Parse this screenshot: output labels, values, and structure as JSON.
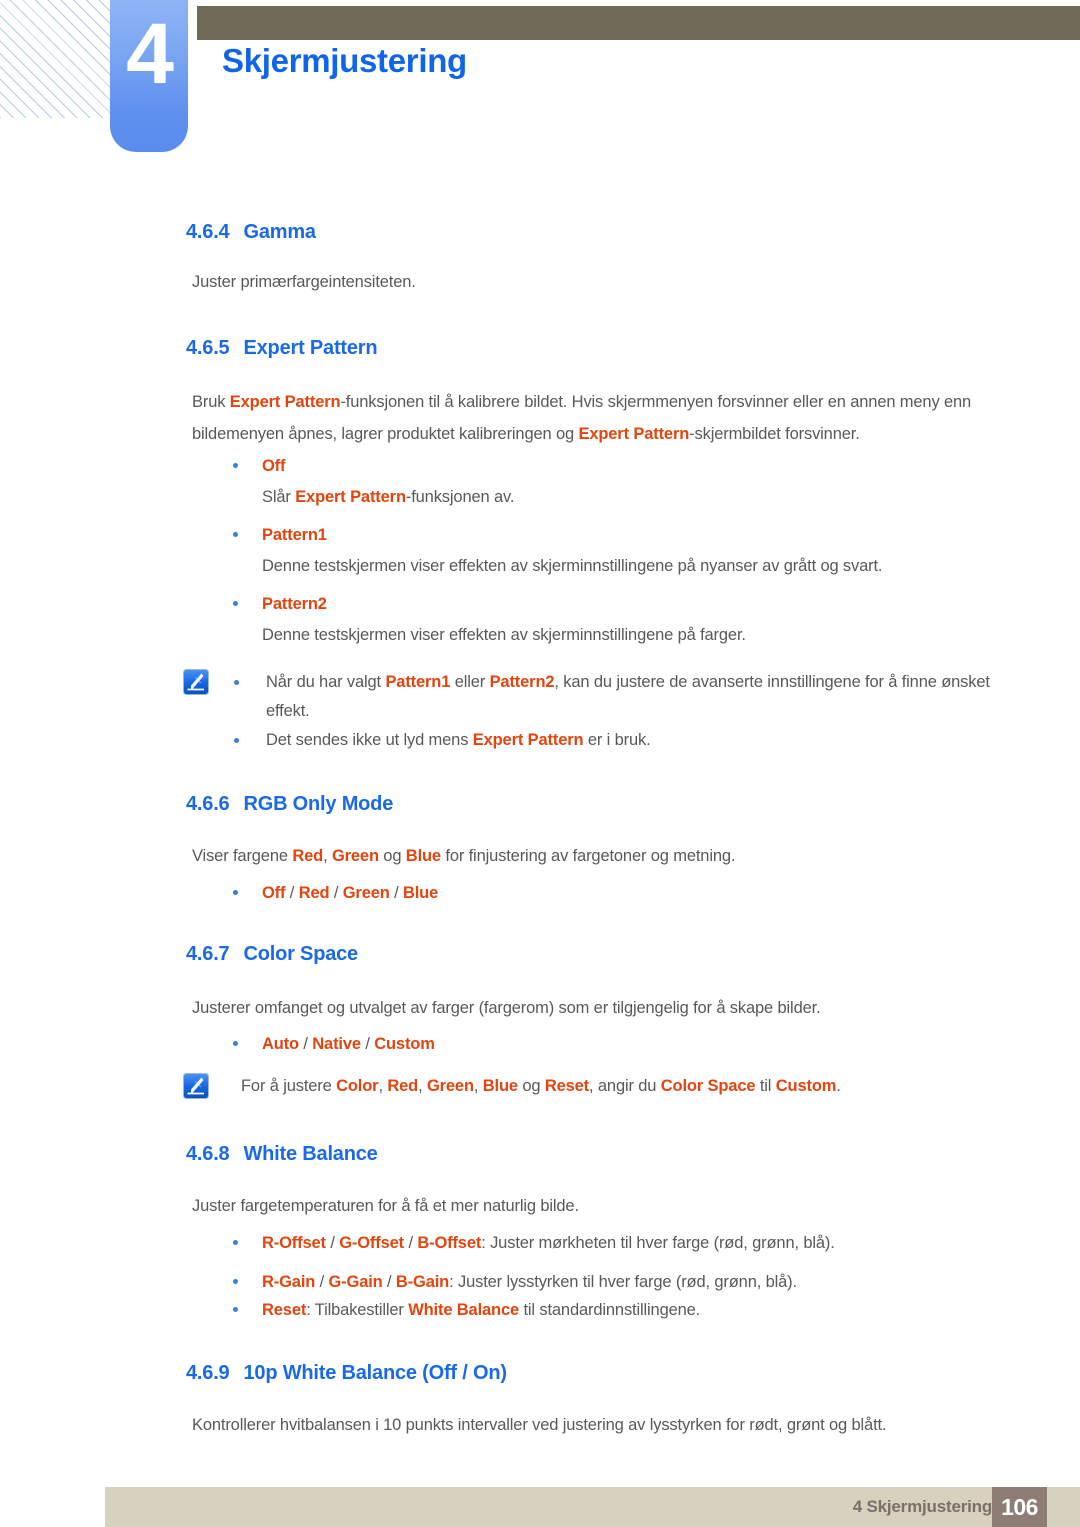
{
  "header": {
    "chapter_number": "4",
    "chapter_title": "Skjermjustering",
    "hatch_icon": "diagonal-hatch-decoration",
    "accent_blue": "#1064e8",
    "badge_blue": "#7aa6f2",
    "olive_bar_color": "#6e6a55"
  },
  "sections": {
    "gamma": {
      "number": "4.6.4",
      "title": "Gamma",
      "body": "Juster primærfargeintensiteten."
    },
    "expert_pattern": {
      "number": "4.6.5",
      "title": "Expert Pattern",
      "intro_1_a": "Bruk ",
      "intro_1_kw": "Expert Pattern",
      "intro_1_b": "-funksjonen til å kalibrere bildet. Hvis skjermmenyen forsvinner eller en annen meny",
      "intro_2_a": "enn bildemenyen åpnes, lagrer produktet kalibreringen og ",
      "intro_2_kw": "Expert Pattern",
      "intro_2_b": "-skjermbildet forsvinner.",
      "options": [
        {
          "label": "Off",
          "desc_a": "Slår ",
          "desc_kw": "Expert Pattern",
          "desc_b": "-funksjonen av."
        },
        {
          "label": "Pattern1",
          "desc": "Denne testskjermen viser effekten av skjerminnstillingene på nyanser av grått og svart."
        },
        {
          "label": "Pattern2",
          "desc": "Denne testskjermen viser effekten av skjerminnstillingene på farger."
        }
      ],
      "note": {
        "icon": "note-pencil-icon",
        "items": [
          {
            "a": "Når du har valgt ",
            "kw1": "Pattern1",
            "b": " eller ",
            "kw2": "Pattern2",
            "c": ", kan du justere de avanserte innstillingene for å finne",
            "line2": "ønsket effekt."
          },
          {
            "a": "Det sendes ikke ut lyd mens ",
            "kw1": "Expert Pattern",
            "b": " er i bruk."
          }
        ]
      }
    },
    "rgb_only_mode": {
      "number": "4.6.6",
      "title": "RGB Only Mode",
      "body_a": "Viser fargene ",
      "body_kw1": "Red",
      "body_b": ", ",
      "body_kw2": "Green",
      "body_c": " og ",
      "body_kw3": "Blue",
      "body_d": " for finjustering av fargetoner og metning.",
      "option_values": [
        "Off",
        "Red",
        "Green",
        "Blue"
      ],
      "option_separator": " / "
    },
    "color_space": {
      "number": "4.6.7",
      "title": "Color Space",
      "body": "Justerer omfanget og utvalget av farger (fargerom) som er tilgjengelig for å skape bilder.",
      "option_values": [
        "Auto",
        "Native",
        "Custom"
      ],
      "option_separator": " / ",
      "note": {
        "icon": "note-pencil-icon",
        "a": "For å justere ",
        "kw1": "Color",
        "b": ", ",
        "kw2": "Red",
        "c": ", ",
        "kw3": "Green",
        "d": ", ",
        "kw4": "Blue",
        "e": " og ",
        "kw5": "Reset",
        "f": ", angir du ",
        "kw6": "Color Space",
        "g": " til ",
        "kw7": "Custom",
        "h": "."
      }
    },
    "white_balance": {
      "number": "4.6.8",
      "title": "White Balance",
      "body": "Juster fargetemperaturen for å få et mer naturlig bilde.",
      "items": [
        {
          "kw1": "R-Offset",
          "s1": " / ",
          "kw2": "G-Offset",
          "s2": " / ",
          "kw3": "B-Offset",
          "rest": ": Juster mørkheten til hver farge (rød, grønn, blå)."
        },
        {
          "kw1": "R-Gain",
          "s1": " / ",
          "kw2": "G-Gain",
          "s2": " / ",
          "kw3": "B-Gain",
          "rest": ": Juster lysstyrken til hver farge (rød, grønn, blå)."
        },
        {
          "kw1": "Reset",
          "rest_a": ": Tilbakestiller ",
          "kw2": "White Balance",
          "rest_b": " til standardinnstillingene."
        }
      ]
    },
    "ten_p_white_balance": {
      "number": "4.6.9",
      "title": "10p White Balance (Off / On)",
      "body": "Kontrollerer hvitbalansen i 10 punkts intervaller ved justering av lysstyrken for rødt, grønt og blått."
    }
  },
  "footer": {
    "label": "4 Skjermjustering",
    "page_number": "106",
    "bar_color": "#d6d2bd",
    "page_box_color": "#8d7d74"
  }
}
